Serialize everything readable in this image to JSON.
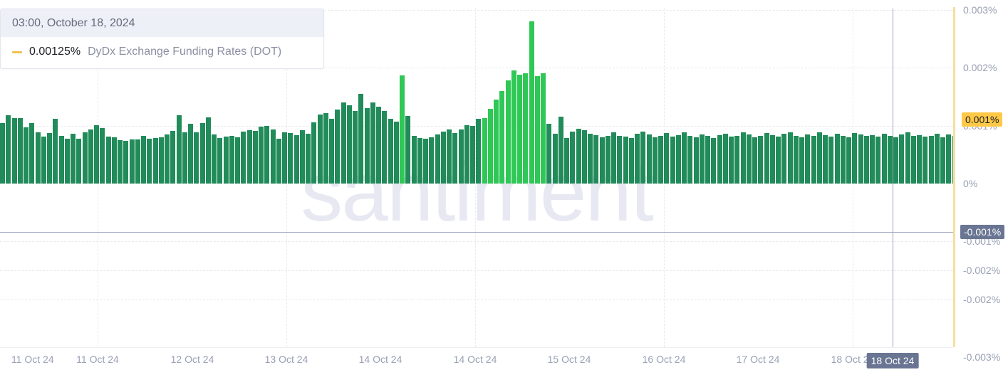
{
  "chart_data": {
    "type": "bar",
    "title": "",
    "subtitle": "",
    "xlabel": "",
    "ylabel": "",
    "grid": true,
    "legend_position": "tooltip-top-left",
    "ylim": [
      -0.003,
      0.003
    ],
    "y_ticks": [
      "0.003%",
      "0.002%",
      "0.001%",
      "0%",
      "-0.001%",
      "-0.002%",
      "-0.002%",
      "-0.003%"
    ],
    "y_tick_values": [
      0.003,
      0.002,
      0.001,
      0,
      -0.001,
      -0.0015,
      -0.002,
      -0.003
    ],
    "x_ticks": [
      "11 Oct 24",
      "11 Oct 24",
      "12 Oct 24",
      "13 Oct 24",
      "14 Oct 24",
      "14 Oct 24",
      "15 Oct 24",
      "16 Oct 24",
      "17 Oct 24",
      "18 Oct 24"
    ],
    "series": [
      {
        "name": "DyDx Exchange Funding Rates (DOT)",
        "color": "#218b5a",
        "highlight_color": "#2fc755",
        "values": [
          0.00105,
          0.00118,
          0.00113,
          0.00113,
          0.00097,
          0.00105,
          0.00088,
          0.00081,
          0.00087,
          0.00112,
          0.00083,
          0.00078,
          0.00086,
          0.00078,
          0.00089,
          0.00093,
          0.00101,
          0.00096,
          0.00081,
          0.0008,
          0.00075,
          0.00074,
          0.00076,
          0.00076,
          0.00082,
          0.00077,
          0.00079,
          0.0008,
          0.00085,
          0.00091,
          0.00118,
          0.00089,
          0.00103,
          0.00088,
          0.00104,
          0.00114,
          0.00085,
          0.00079,
          0.00081,
          0.00082,
          0.0008,
          0.0009,
          0.00092,
          0.00091,
          0.00098,
          0.00099,
          0.00094,
          0.00077,
          0.00089,
          0.00087,
          0.00084,
          0.00092,
          0.00086,
          0.00106,
          0.00119,
          0.00122,
          0.00112,
          0.00128,
          0.0014,
          0.00135,
          0.00126,
          0.00155,
          0.0013,
          0.0014,
          0.00133,
          0.00125,
          0.00112,
          0.00107,
          0.00187,
          0.00117,
          0.00082,
          0.00079,
          0.00078,
          0.0008,
          0.00085,
          0.0009,
          0.00093,
          0.00087,
          0.00094,
          0.00101,
          0.00099,
          0.00112,
          0.00113,
          0.00129,
          0.00145,
          0.0016,
          0.00178,
          0.00195,
          0.00188,
          0.0019,
          0.0028,
          0.00186,
          0.00191,
          0.00103,
          0.00086,
          0.00115,
          0.00079,
          0.0009,
          0.00095,
          0.00092,
          0.00086,
          0.00084,
          0.0008,
          0.00083,
          0.00088,
          0.00082,
          0.00081,
          0.00079,
          0.00086,
          0.0009,
          0.00085,
          0.0008,
          0.00083,
          0.00087,
          0.00081,
          0.00084,
          0.00088,
          0.00083,
          0.0008,
          0.00085,
          0.00082,
          0.00079,
          0.00084,
          0.00086,
          0.00081,
          0.00083,
          0.00088,
          0.00085,
          0.0008,
          0.00082,
          0.00087,
          0.00084,
          0.00081,
          0.00086,
          0.00089,
          0.00083,
          0.0008,
          0.00085,
          0.00082,
          0.00088,
          0.00084,
          0.00081,
          0.00086,
          0.00083,
          0.0008,
          0.00087,
          0.00085,
          0.00082,
          0.00084,
          0.00081,
          0.00086,
          0.00083,
          0.0008,
          0.00085,
          0.00088,
          0.00082,
          0.00084,
          0.00081,
          0.00083,
          0.00086,
          0.0008,
          0.00085,
          0.00082,
          0.00087,
          0.00084,
          0.00081,
          0.00083,
          0.00086,
          0.0008,
          0.00085,
          0.00088,
          0.00082,
          0.00084,
          0.00081,
          0.00086,
          0.00083,
          0.0008,
          0.00085,
          0.00087,
          0.00082,
          0.00084
        ],
        "highlight_indices": [
          68,
          82,
          83,
          84,
          85,
          86,
          87,
          88,
          89,
          90,
          91,
          92
        ]
      }
    ]
  },
  "tooltip": {
    "timestamp": "03:00, October 18, 2024",
    "value": "0.00125%",
    "label": "DyDx Exchange Funding Rates (DOT)"
  },
  "crosshair": {
    "y_label": "0.001%",
    "y_label_lower": "-0.001%",
    "x_label": "18 Oct 24"
  },
  "watermark": {
    "text": "santiment"
  },
  "colors": {
    "bar": "#218b5a",
    "bar_highlight": "#2fc755",
    "crosshair": "#9aa3bd",
    "y_axis": "#f7dfa0",
    "highlight_yellow": "#ffc947",
    "highlight_slate": "#697593",
    "grid": "#e9e9ee",
    "tick_text": "#9aa0b4"
  }
}
